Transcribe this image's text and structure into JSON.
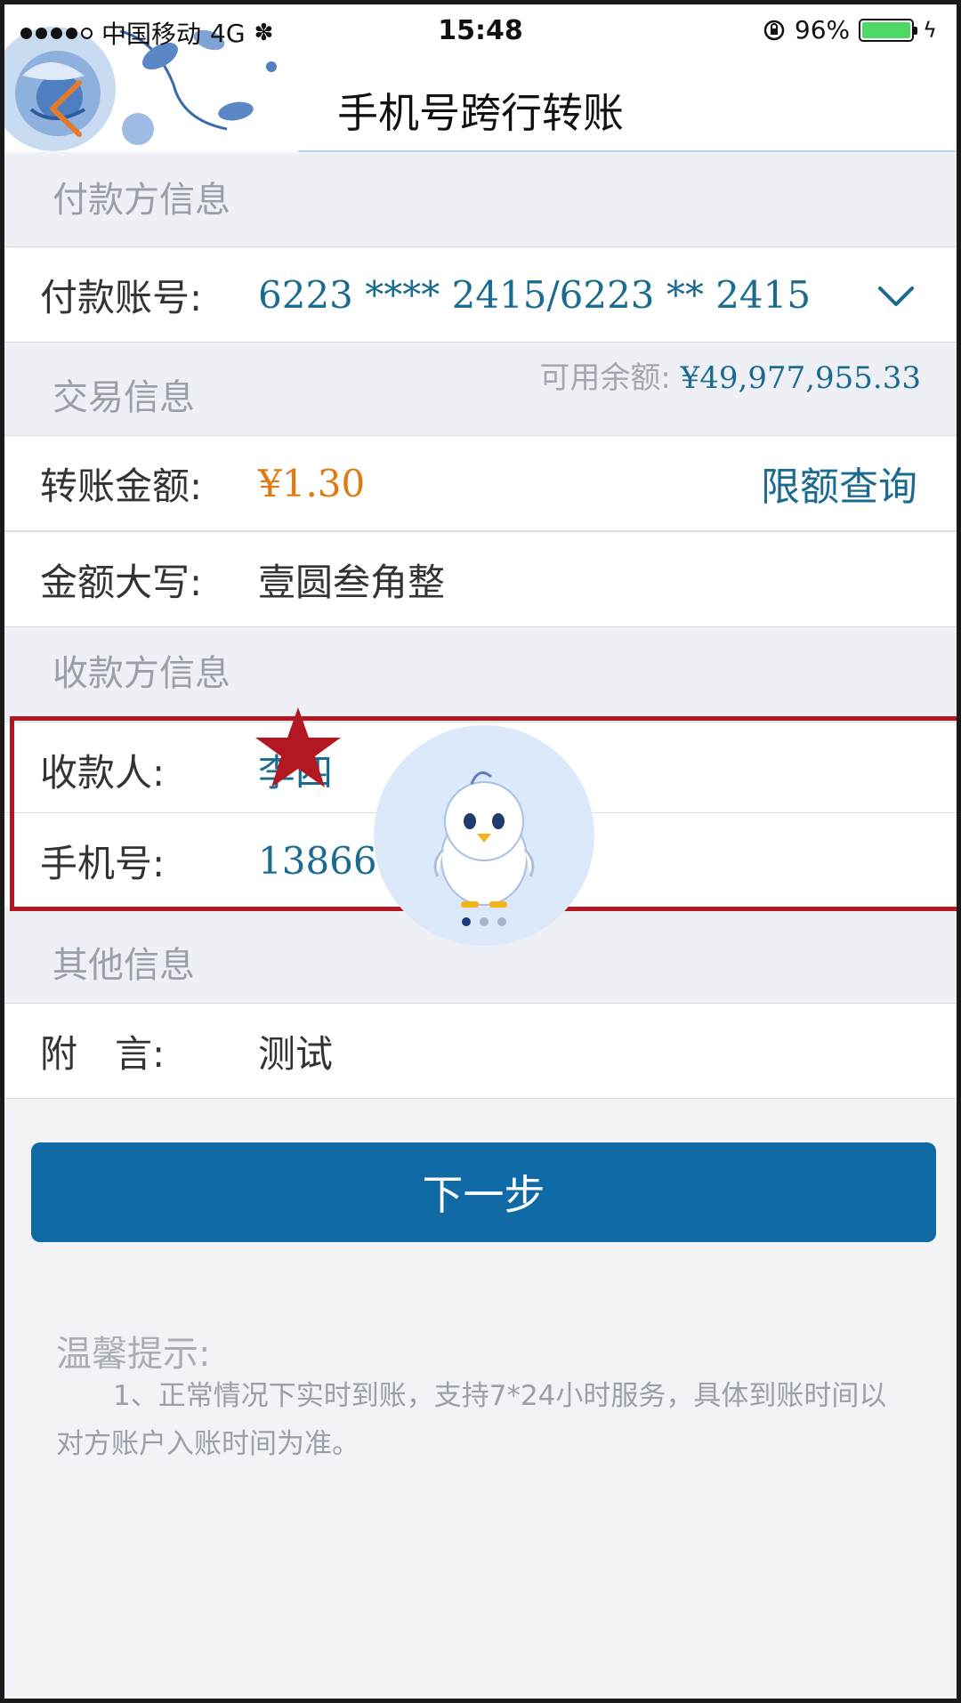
{
  "status_bar": {
    "carrier": "中国移动",
    "network": "4G",
    "time": "15:48",
    "battery": "96%",
    "battery_level": 0.96
  },
  "header": {
    "title": "手机号跨行转账",
    "back_icon": "chevron-left-icon"
  },
  "payer_section": {
    "title": "付款方信息",
    "account_label": "付款账号:",
    "account_value": "6223 **** 2415/6223 ** 2415",
    "available_label": "可用余额:",
    "available_value": "¥49,977,955.33"
  },
  "transaction_section": {
    "title": "交易信息",
    "amount_label": "转账金额:",
    "amount_value": "¥1.30",
    "limit_link": "限额查询",
    "uppercase_label": "金额大写:",
    "uppercase_value": "壹圆叁角整"
  },
  "payee_section": {
    "title": "收款方信息",
    "name_label": "收款人:",
    "name_value": "李四",
    "phone_label": "手机号:",
    "phone_value": "138666"
  },
  "other_section": {
    "title": "其他信息",
    "note_label": "附　言:",
    "note_value": "测试"
  },
  "next_button": "下一步",
  "tips": {
    "title": "温馨提示:",
    "body": "1、正常情况下实时到账，支持7*24小时服务，具体到账时间以对方账户入账时间为准。"
  },
  "colors": {
    "accent": "#0f6aa6",
    "value_text": "#1a6b8f",
    "amount_text": "#e07a10",
    "highlight_border": "#b31822",
    "background": "#f2f3f7"
  }
}
